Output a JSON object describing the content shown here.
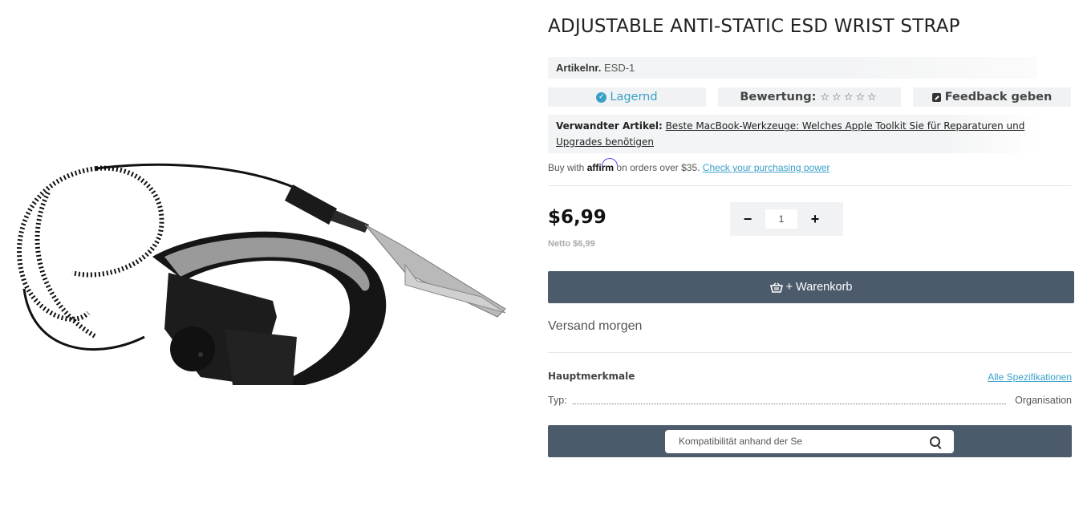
{
  "product": {
    "title": "ADJUSTABLE ANTI-STATIC ESD WRIST STRAP",
    "image_alt": "Anti-static ESD wrist strap with coiled cord and alligator clip",
    "sku_label": "Artikelnr.",
    "sku_value": "ESD-1",
    "stock_label": "Lagernd",
    "rating_label": "Bewertung:",
    "rating_stars": "☆ ☆ ☆ ☆ ☆",
    "rating_value": 0,
    "rating_max": 5,
    "feedback_label": "Feedback geben",
    "related_label": "Verwandter Artikel:",
    "related_link": "Beste MacBook-Werkzeuge: Welches Apple Toolkit Sie für Reparaturen und Upgrades benötigen",
    "affirm": {
      "prefix": "Buy with",
      "logo": "affirm",
      "suffix": "on orders over $35.",
      "link": "Check your purchasing power"
    },
    "price": "$6,99",
    "netto": "Netto $6,99",
    "quantity": {
      "minus": "−",
      "value": "1",
      "plus": "+"
    },
    "cart_label": "+ Warenkorb",
    "shipping": "Versand morgen",
    "specs": {
      "heading": "Hauptmerkmale",
      "all_link": "Alle Spezifikationen",
      "rows": [
        {
          "key": "Typ:",
          "value": "Organisation"
        }
      ]
    },
    "compat_placeholder": "Kompatibilität anhand der Se"
  },
  "colors": {
    "accent": "#3aa0c9",
    "button": "#4c5b6b",
    "pill_bg": "#f1f2f3"
  },
  "icons": {
    "stock": "check-circle-icon",
    "feedback": "edit-icon",
    "cart": "basket-icon",
    "search": "search-icon"
  }
}
